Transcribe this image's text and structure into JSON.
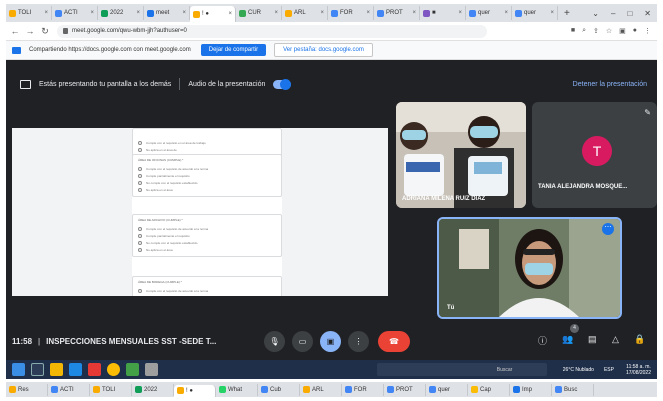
{
  "browser": {
    "tabs": [
      {
        "label": "TOLI",
        "color": "#f9ab00",
        "active": false
      },
      {
        "label": "ACTI",
        "color": "#4285f4",
        "active": false
      },
      {
        "label": "2022",
        "color": "#0f9d58",
        "active": false
      },
      {
        "label": "meet",
        "color": "#1a73e8",
        "active": false
      },
      {
        "label": "! ●",
        "color": "#f9ab00",
        "active": true
      },
      {
        "label": "CUR",
        "color": "#34a853",
        "active": false
      },
      {
        "label": "ARL",
        "color": "#f9ab00",
        "active": false
      },
      {
        "label": "FOR",
        "color": "#4285f4",
        "active": false
      },
      {
        "label": "PROT",
        "color": "#4285f4",
        "active": false
      },
      {
        "label": "■",
        "color": "#7e57c2",
        "active": false
      },
      {
        "label": "quer",
        "color": "#4285f4",
        "active": false
      },
      {
        "label": "quer",
        "color": "#4285f4",
        "active": false
      }
    ],
    "new_tab": "+",
    "window_controls": [
      "⌄",
      "–",
      "□",
      "✕"
    ],
    "url": "meet.google.com/qwu-wbm-jjh?authuser=0"
  },
  "sharing_bar": {
    "text": "Compartiendo https://docs.google.com con meet.google.com",
    "stop_label": "Dejar de compartir",
    "show_label": "Ver pestaña: docs.google.com"
  },
  "meet": {
    "presenting_text": "Estás presentando tu pantalla a los demás",
    "audio_label": "Audio de la presentación",
    "stop_presenting": "Detener la presentación",
    "participants": [
      {
        "name": "ADRIANA MILENA RUIZ DIAZ",
        "kind": "video"
      },
      {
        "name": "TANIA ALEJANDRA MOSQUE...",
        "initial": "T",
        "kind": "avatar"
      },
      {
        "name": "Tú",
        "kind": "self"
      }
    ],
    "time": "11:58",
    "meeting_title": "INSPECCIONES MENSUALES SST -SEDE T...",
    "people_count": "4"
  },
  "doc": {
    "cards": [
      {
        "question": "",
        "options": [
          "Cumple con el requisito en el área de trabajo",
          "No aplica en el área de"
        ]
      },
      {
        "question": "ÁREA DE OFICINAS (CUMPLE) *",
        "options": [
          "Cumple con el requisito de acuerdo a la norma",
          "Cumple parcialmente el requisito",
          "No cumple con el requisito establecido",
          "No aplica en el área"
        ]
      },
      {
        "question": "ÁREA DE ARCHIVO (CUMPLE) *",
        "options": [
          "Cumple con el requisito de acuerdo a la norma",
          "Cumple parcialmente el requisito",
          "No cumple con el requisito establecido",
          "No aplica en el área"
        ]
      },
      {
        "question": "ÁREA DE BODEGA (CUMPLE) *",
        "options": [
          "Cumple con el requisito de acuerdo a la norma"
        ]
      }
    ]
  },
  "taskbar": {
    "search_placeholder": "Buscar",
    "weather": "26°C Nublado",
    "time": "11:58 a. m.",
    "date": "17/08/2022",
    "lang": "ESP"
  },
  "tabs_bottom": [
    "Res",
    "ACTI",
    "TOLI",
    "2022",
    "! ●",
    "What",
    "Cub",
    "ARL",
    "FOR",
    "PROT",
    "quer",
    "Cap",
    "Imp",
    "Busc"
  ]
}
